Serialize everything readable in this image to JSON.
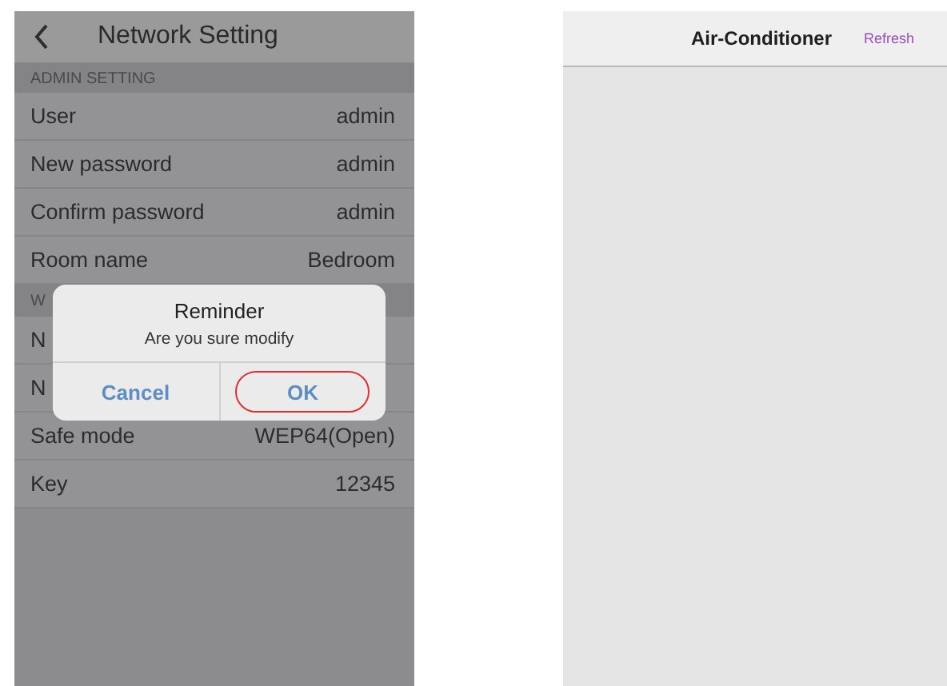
{
  "network_screen": {
    "nav": {
      "title": "Network Setting"
    },
    "sections": [
      {
        "header": "ADMIN SETTING",
        "rows": [
          {
            "label": "User",
            "value": "admin"
          },
          {
            "label": "New password",
            "value": "admin"
          },
          {
            "label": "Confirm password",
            "value": "admin"
          },
          {
            "label": "Room name",
            "value": "Bedroom"
          }
        ]
      },
      {
        "header": "W",
        "rows": [
          {
            "label": "N"
          },
          {
            "label": "N"
          },
          {
            "label": "Safe mode",
            "value": "WEP64(Open)"
          },
          {
            "label": "Key",
            "value": "12345"
          }
        ]
      }
    ],
    "dialog": {
      "title": "Reminder",
      "message": "Are you sure modify",
      "buttons": [
        {
          "label": "Cancel",
          "highlighted": false
        },
        {
          "label": "OK",
          "highlighted": true
        }
      ]
    }
  },
  "ac_screen": {
    "title": "Air-Conditioner",
    "action": "Refresh"
  }
}
